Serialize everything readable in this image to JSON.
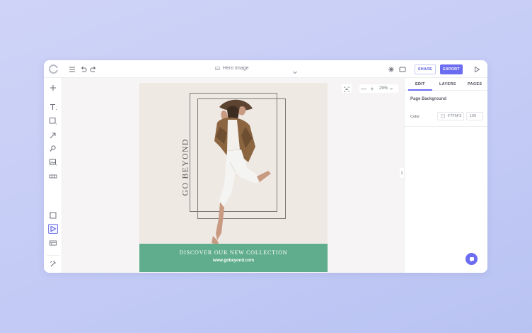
{
  "topbar": {
    "document_title": "Hero Image",
    "share_label": "SHARE",
    "export_label": "EXPORT",
    "icons": [
      "app-logo-icon",
      "menu-icon",
      "undo-icon",
      "redo-icon",
      "image-icon",
      "chevron-down-icon",
      "sparkle-icon",
      "preview-screen-icon",
      "play-icon"
    ]
  },
  "left_toolbar": {
    "icons": [
      "plus-icon",
      "text-icon",
      "shape-icon",
      "arrow-icon",
      "brush-icon",
      "image-upload-icon",
      "table-icon",
      "frame-icon",
      "select-cursor-icon",
      "layout-icon",
      "settings-icon"
    ]
  },
  "canvas": {
    "zoom_minus": "—",
    "zoom_plus": "+",
    "zoom_value": "29%",
    "design": {
      "vertical_text": "GO BEYOND",
      "banner_title": "DISCOVER OUR NEW COLLECTION",
      "banner_url": "www.gobeyond.com",
      "background_color": "#EFE9E4",
      "banner_color": "#60AD8D"
    }
  },
  "right_panel": {
    "tabs": [
      {
        "label": "EDIT",
        "active": true
      },
      {
        "label": "LAYERS",
        "active": false
      },
      {
        "label": "PAGES",
        "active": false
      }
    ],
    "section_title": "Page Background",
    "color_label": "Color",
    "color_value": "F7F5F3",
    "opacity_value": "100"
  },
  "colors": {
    "accent": "#6B6CF0",
    "page_background": "#F7F5F3"
  }
}
